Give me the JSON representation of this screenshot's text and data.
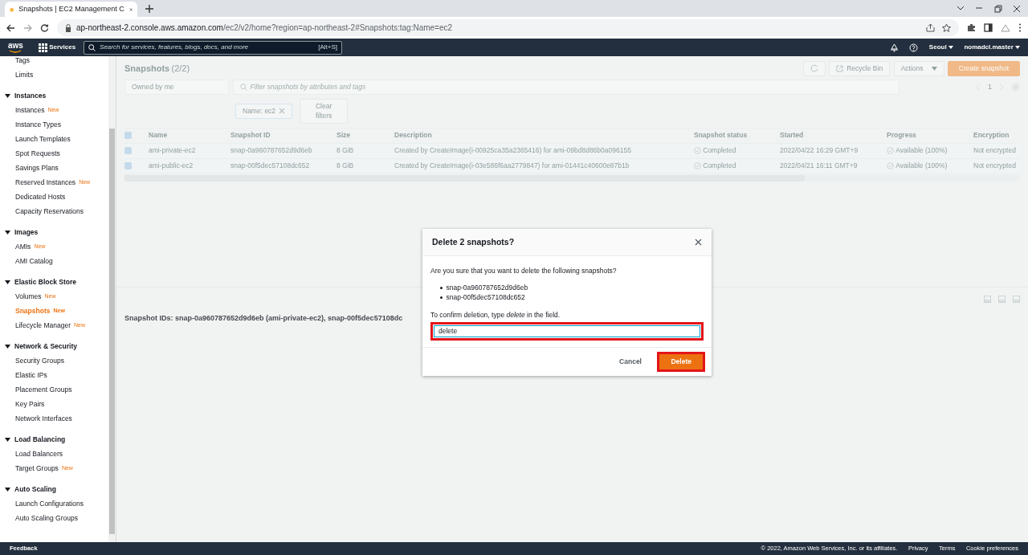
{
  "browser": {
    "tab_title": "Snapshots | EC2 Management C",
    "url_host": "ap-northeast-2.console.aws.amazon.com",
    "url_path": "/ec2/v2/home?region=ap-northeast-2#Snapshots:tag:Name=ec2"
  },
  "topnav": {
    "logo": "aws",
    "services": "Services",
    "search_placeholder": "Search for services, features, blogs, docs, and more",
    "search_shortcut": "[Alt+S]",
    "region": "Seoul",
    "account": "nomadcl.master"
  },
  "sidebar": {
    "top_items": [
      {
        "label": "Tags",
        "selected": false
      },
      {
        "label": "Limits",
        "selected": false
      }
    ],
    "groups": [
      {
        "title": "Instances",
        "expanded": true,
        "items": [
          {
            "label": "Instances",
            "badge": "New",
            "selected": false
          },
          {
            "label": "Instance Types",
            "selected": false
          },
          {
            "label": "Launch Templates",
            "selected": false
          },
          {
            "label": "Spot Requests",
            "selected": false
          },
          {
            "label": "Savings Plans",
            "selected": false
          },
          {
            "label": "Reserved Instances",
            "badge": "New",
            "selected": false
          },
          {
            "label": "Dedicated Hosts",
            "selected": false
          },
          {
            "label": "Capacity Reservations",
            "selected": false
          }
        ]
      },
      {
        "title": "Images",
        "expanded": true,
        "items": [
          {
            "label": "AMIs",
            "badge": "New",
            "selected": false
          },
          {
            "label": "AMI Catalog",
            "selected": false
          }
        ]
      },
      {
        "title": "Elastic Block Store",
        "expanded": true,
        "items": [
          {
            "label": "Volumes",
            "badge": "New",
            "selected": false
          },
          {
            "label": "Snapshots",
            "badge": "New",
            "selected": true
          },
          {
            "label": "Lifecycle Manager",
            "badge": "New",
            "selected": false
          }
        ]
      },
      {
        "title": "Network & Security",
        "expanded": true,
        "items": [
          {
            "label": "Security Groups",
            "selected": false
          },
          {
            "label": "Elastic IPs",
            "selected": false
          },
          {
            "label": "Placement Groups",
            "selected": false
          },
          {
            "label": "Key Pairs",
            "selected": false
          },
          {
            "label": "Network Interfaces",
            "selected": false
          }
        ]
      },
      {
        "title": "Load Balancing",
        "expanded": true,
        "items": [
          {
            "label": "Load Balancers",
            "selected": false
          },
          {
            "label": "Target Groups",
            "badge": "New",
            "selected": false
          }
        ]
      },
      {
        "title": "Auto Scaling",
        "expanded": true,
        "items": [
          {
            "label": "Launch Configurations",
            "selected": false
          },
          {
            "label": "Auto Scaling Groups",
            "selected": false
          }
        ]
      }
    ]
  },
  "panel": {
    "title": "Snapshots",
    "count": "(2/2)",
    "recycle_bin": "Recycle Bin",
    "actions": "Actions",
    "create": "Create snapshot",
    "owner_filter": "Owned by me",
    "filter_placeholder": "Filter snapshots by attributes and tags",
    "token": "Name: ec2",
    "clear": "Clear filters",
    "page": "1"
  },
  "table": {
    "all_checked": true,
    "columns": [
      "Name",
      "Snapshot ID",
      "Size",
      "Description",
      "Snapshot status",
      "Started",
      "Progress",
      "Encryption"
    ],
    "rows": [
      {
        "checked": true,
        "cells": [
          "ami-private-ec2",
          "snap-0a960787652d9d6eb",
          "8 GiB",
          "Created by CreateImage(i-00925ca35a2365416) for ami-09bd8d86b0a096155",
          "Completed",
          "2022/04/22 16:29 GMT+9",
          "Available (100%)",
          "Not encrypted"
        ]
      },
      {
        "checked": true,
        "cells": [
          "ami-public-ec2",
          "snap-00f5dec57108dc652",
          "8 GiB",
          "Created by CreateImage(i-03e586f6aa2779847) for ami-01441c40600e87b1b",
          "Completed",
          "2022/04/21 16:11 GMT+9",
          "Available (100%)",
          "Not encrypted"
        ]
      }
    ]
  },
  "details": {
    "text": "Snapshot IDs: snap-0a960787652d9d6eb (ami-private-ec2), snap-00f5dec57108dc"
  },
  "modal": {
    "title": "Delete 2 snapshots?",
    "question": "Are you sure that you want to delete the following snapshots?",
    "items": [
      "snap-0a960787652d9d6eb",
      "snap-00f5dec57108dc652"
    ],
    "confirm": "To confirm deletion, type *delete* in the field.",
    "value": "delete",
    "cancel": "Cancel",
    "delete": "Delete"
  },
  "footer": {
    "feedback": "Feedback",
    "copyright": "© 2022, Amazon Web Services, Inc. or its affiliates.",
    "links": [
      "Privacy",
      "Terms",
      "Cookie preferences"
    ]
  }
}
